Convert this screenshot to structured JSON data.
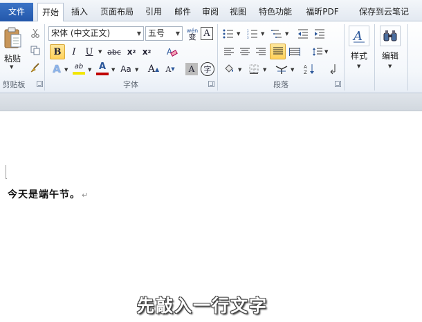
{
  "tabs": {
    "file": "文件",
    "items": [
      "开始",
      "插入",
      "页面布局",
      "引用",
      "邮件",
      "审阅",
      "视图",
      "特色功能",
      "福昕PDF",
      "保存到云笔记"
    ],
    "active": "开始"
  },
  "clipboard": {
    "paste_label": "粘贴",
    "group_label": "剪贴板"
  },
  "font": {
    "name_value": "宋体 (中文正文)",
    "size_value": "五号",
    "wen_icon_text": "wén",
    "wen_glyph": "变",
    "char_border_text": "A",
    "bold": "B",
    "italic": "I",
    "underline": "U",
    "strike": "abc",
    "sub": "x",
    "sub_mark": "2",
    "sup": "x",
    "sup_mark": "2",
    "clear_text": "A",
    "effect_text": "A",
    "highlight_text": "ab",
    "color_text": "A",
    "case_text": "Aa",
    "grow_text": "A",
    "shrink_text": "A",
    "shade_text": "A",
    "enclose_text": "字",
    "group_label": "字体"
  },
  "paragraph": {
    "group_label": "段落"
  },
  "styles": {
    "label": "样式"
  },
  "editing": {
    "label": "编辑"
  },
  "colors": {
    "highlight": "#f2e600",
    "font_color": "#c00000",
    "accent": "#2b579a"
  },
  "document": {
    "paragraph_text": "今天是端午节。",
    "paragraph_mark": "↵",
    "caption": "先敲入一行文字"
  }
}
